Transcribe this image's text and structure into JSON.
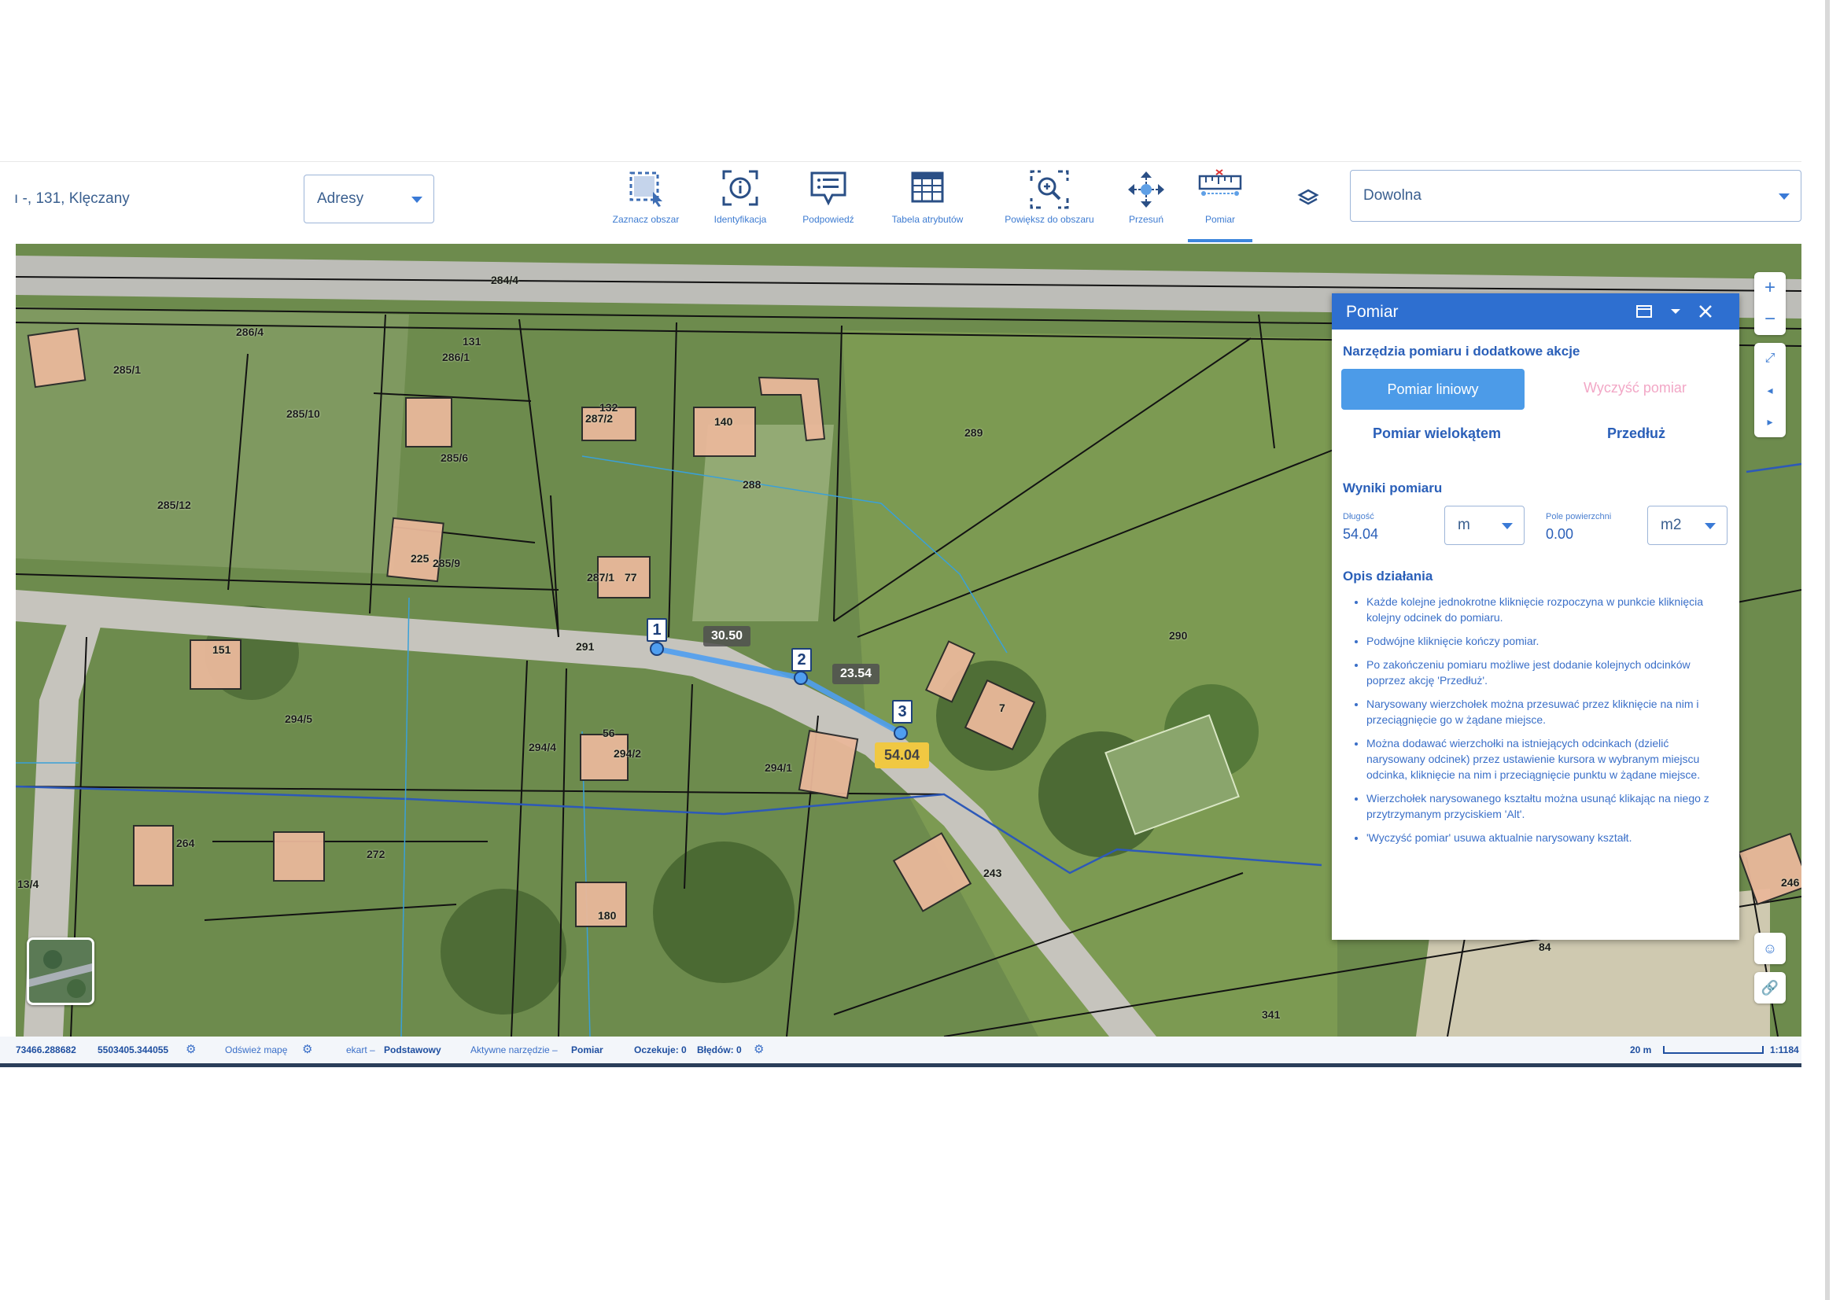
{
  "address_text": "ı -, 131, Klęczany",
  "search_mode": {
    "value": "Adresy"
  },
  "scale_select": {
    "value": "Dowolna"
  },
  "tools": [
    {
      "name": "select-area",
      "label": "Zaznacz obszar"
    },
    {
      "name": "identify",
      "label": "Identyfikacja"
    },
    {
      "name": "hint",
      "label": "Podpowiedź"
    },
    {
      "name": "attribute-table",
      "label": "Tabela atrybutów"
    },
    {
      "name": "zoom-area",
      "label": "Powiększ do obszaru"
    },
    {
      "name": "pan",
      "label": "Przesuń"
    },
    {
      "name": "measure",
      "label": "Pomiar"
    }
  ],
  "parcels": [
    "284/4",
    "286/4",
    "285/1",
    "131",
    "286/1",
    "285/10",
    "285/6",
    "285/12",
    "132",
    "287/2",
    "140",
    "288",
    "289",
    "225",
    "285/9",
    "287/1",
    "77",
    "291",
    "290",
    "151",
    "294/5",
    "56",
    "294/4",
    "294/2",
    "294/1",
    "7",
    "264",
    "272",
    "243",
    "180",
    "246",
    "84",
    "341",
    "13/4"
  ],
  "measurement": {
    "points": [
      "1",
      "2",
      "3"
    ],
    "segments": [
      "30.50",
      "23.54"
    ],
    "total": "54.04"
  },
  "panel": {
    "title": "Pomiar",
    "tools_title": "Narzędzia pomiaru i dodatkowe akcje",
    "btn_line": "Pomiar liniowy",
    "btn_clear": "Wyczyść pomiar",
    "btn_polygon": "Pomiar wielokątem",
    "btn_extend": "Przedłuż",
    "results_title": "Wyniki pomiaru",
    "length_label": "Długość",
    "length_value": "54.04",
    "length_unit": "m",
    "area_label": "Pole powierzchni",
    "area_value": "0.00",
    "area_unit": "m2",
    "desc_title": "Opis działania",
    "desc_items": [
      "Każde kolejne jednokrotne kliknięcie rozpoczyna w punkcie kliknięcia kolejny odcinek do pomiaru.",
      "Podwójne kliknięcie kończy pomiar.",
      "Po zakończeniu pomiaru możliwe jest dodanie kolejnych odcinków poprzez akcję 'Przedłuż'.",
      "Narysowany wierzchołek można przesuwać przez kliknięcie na nim i przeciągnięcie go w żądane miejsce.",
      "Można dodawać wierzchołki na istniejących odcinkach (dzielić narysowany odcinek) przez ustawienie kursora w wybranym miejscu odcinka, kliknięcie na nim i przeciągnięcie punktu w żądane miejsce.",
      "Wierzchołek narysowanego kształtu można usunąć klikając na niego z przytrzymanym przyciskiem 'Alt'.",
      "'Wyczyść pomiar' usuwa aktualnie narysowany kształt."
    ]
  },
  "status_bar": {
    "coord_x": "73466.288682",
    "coord_y": "5503405.344055",
    "refresh": "Odśwież mapę",
    "ekart_label": "ekart –",
    "ekart_value": "Podstawowy",
    "active_tool_label": "Aktywne narzędzie –",
    "active_tool_value": "Pomiar",
    "waiting": "Oczekuje: 0",
    "errors": "Błędów: 0",
    "scale_bar_label": "20 m",
    "scale_ratio": "1:1184"
  }
}
